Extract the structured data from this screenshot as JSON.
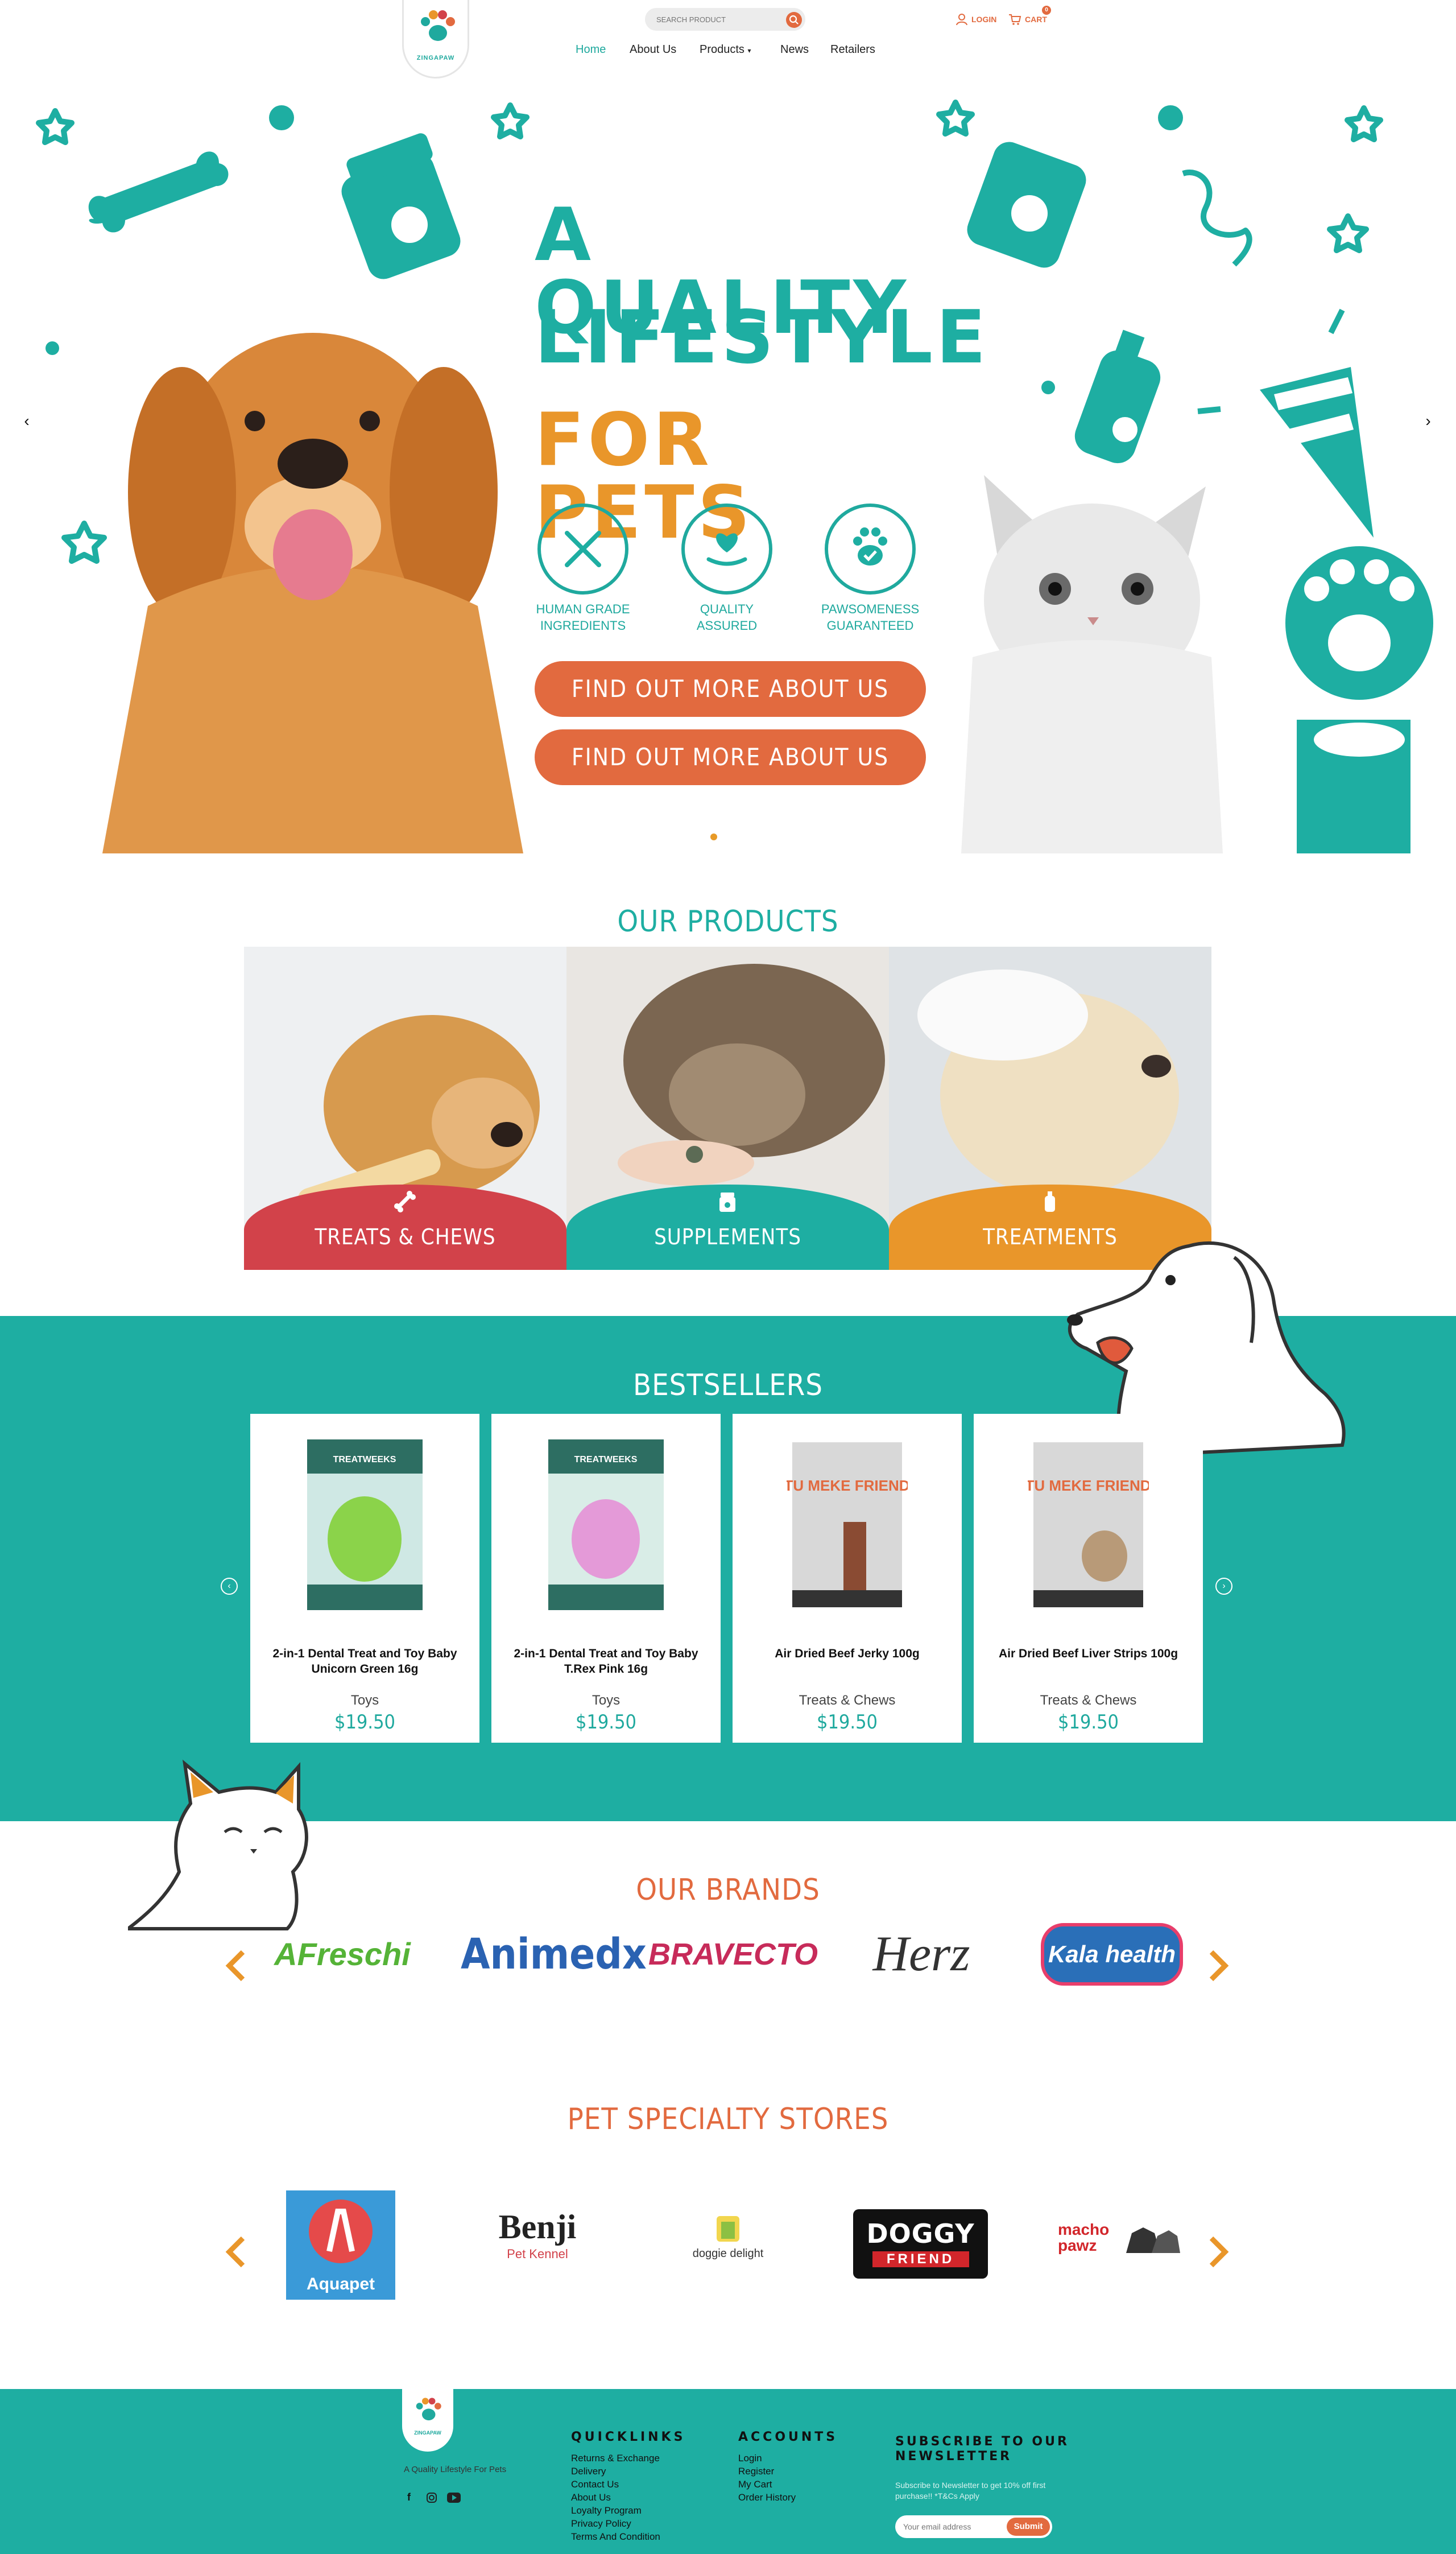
{
  "header": {
    "logo_text": "ZINGAPAW",
    "search_placeholder": "SEARCH PRODUCT",
    "login_label": "LOGIN",
    "cart_label": "CART",
    "cart_count": "0",
    "nav": [
      "Home",
      "About Us",
      "Products",
      "News",
      "Retailers"
    ]
  },
  "hero": {
    "title_line1": "A QUALITY",
    "title_line2": "LIFESTYLE",
    "title_line3": "FOR PETS",
    "features": [
      {
        "label": "HUMAN GRADE INGREDIENTS",
        "icon": "fork-knife-icon"
      },
      {
        "label": "QUALITY ASSURED",
        "icon": "heart-hand-icon"
      },
      {
        "label": "PAWSOMENESS GUARANTEED",
        "icon": "paw-check-icon"
      }
    ],
    "cta_1": "FIND OUT MORE ABOUT US",
    "cta_2": "FIND OUT MORE ABOUT US",
    "prev_arrow": "‹",
    "next_arrow": "›"
  },
  "products": {
    "title": "OUR PRODUCTS",
    "items": [
      {
        "label": "TREATS & CHEWS",
        "color": "#d2424a",
        "icon": "bone-icon"
      },
      {
        "label": "SUPPLEMENTS",
        "color": "#1eaea2",
        "icon": "jar-icon"
      },
      {
        "label": "TREATMENTS",
        "color": "#e9962a",
        "icon": "bottle-icon"
      }
    ]
  },
  "bestsellers": {
    "title": "BESTSELLERS",
    "items": [
      {
        "name": "2-in-1 Dental Treat and Toy Baby Unicorn Green 16g",
        "category": "Toys",
        "price": "$19.50"
      },
      {
        "name": "2-in-1 Dental Treat and Toy Baby T.Rex Pink 16g",
        "category": "Toys",
        "price": "$19.50"
      },
      {
        "name": "Air Dried Beef Jerky 100g",
        "category": "Treats & Chews",
        "price": "$19.50"
      },
      {
        "name": "Air Dried Beef Liver Strips 100g",
        "category": "Treats & Chews",
        "price": "$19.50"
      }
    ],
    "pack_brand_1": "TREATWEEKS",
    "pack_brand_2": "TU MEKE FRIEND"
  },
  "brands": {
    "title": "OUR BRANDS",
    "items": [
      "AFreschi",
      "Animedx",
      "BRAVECTO",
      "Herz",
      "Kala health"
    ]
  },
  "stores": {
    "title": "PET SPECIALTY STORES",
    "items": [
      "Aquapet",
      "Benji",
      "Pet Kennel",
      "doggie delight",
      "DOGGY",
      "FRIEND",
      "macho pawz"
    ]
  },
  "footer": {
    "tagline": "A Quality Lifestyle For Pets",
    "quicklinks_title": "QUICKLINKS",
    "quicklinks": [
      "Returns & Exchange",
      "Delivery",
      "Contact Us",
      "About Us",
      "Loyalty Program",
      "Privacy Policy",
      "Terms And Condition"
    ],
    "accounts_title": "ACCOUNTS",
    "accounts": [
      "Login",
      "Register",
      "My Cart",
      "Order History"
    ],
    "newsletter_title": "SUBSCRIBE TO OUR NEWSLETTER",
    "newsletter_text": "Subscribe to Newsletter to get 10% off first purchase!! *T&Cs Apply",
    "email_placeholder": "Your email address",
    "submit_label": "Submit"
  },
  "colors": {
    "teal": "#1eaea2",
    "orange": "#e26a3f",
    "gold": "#e9962a",
    "red": "#d2424a"
  }
}
